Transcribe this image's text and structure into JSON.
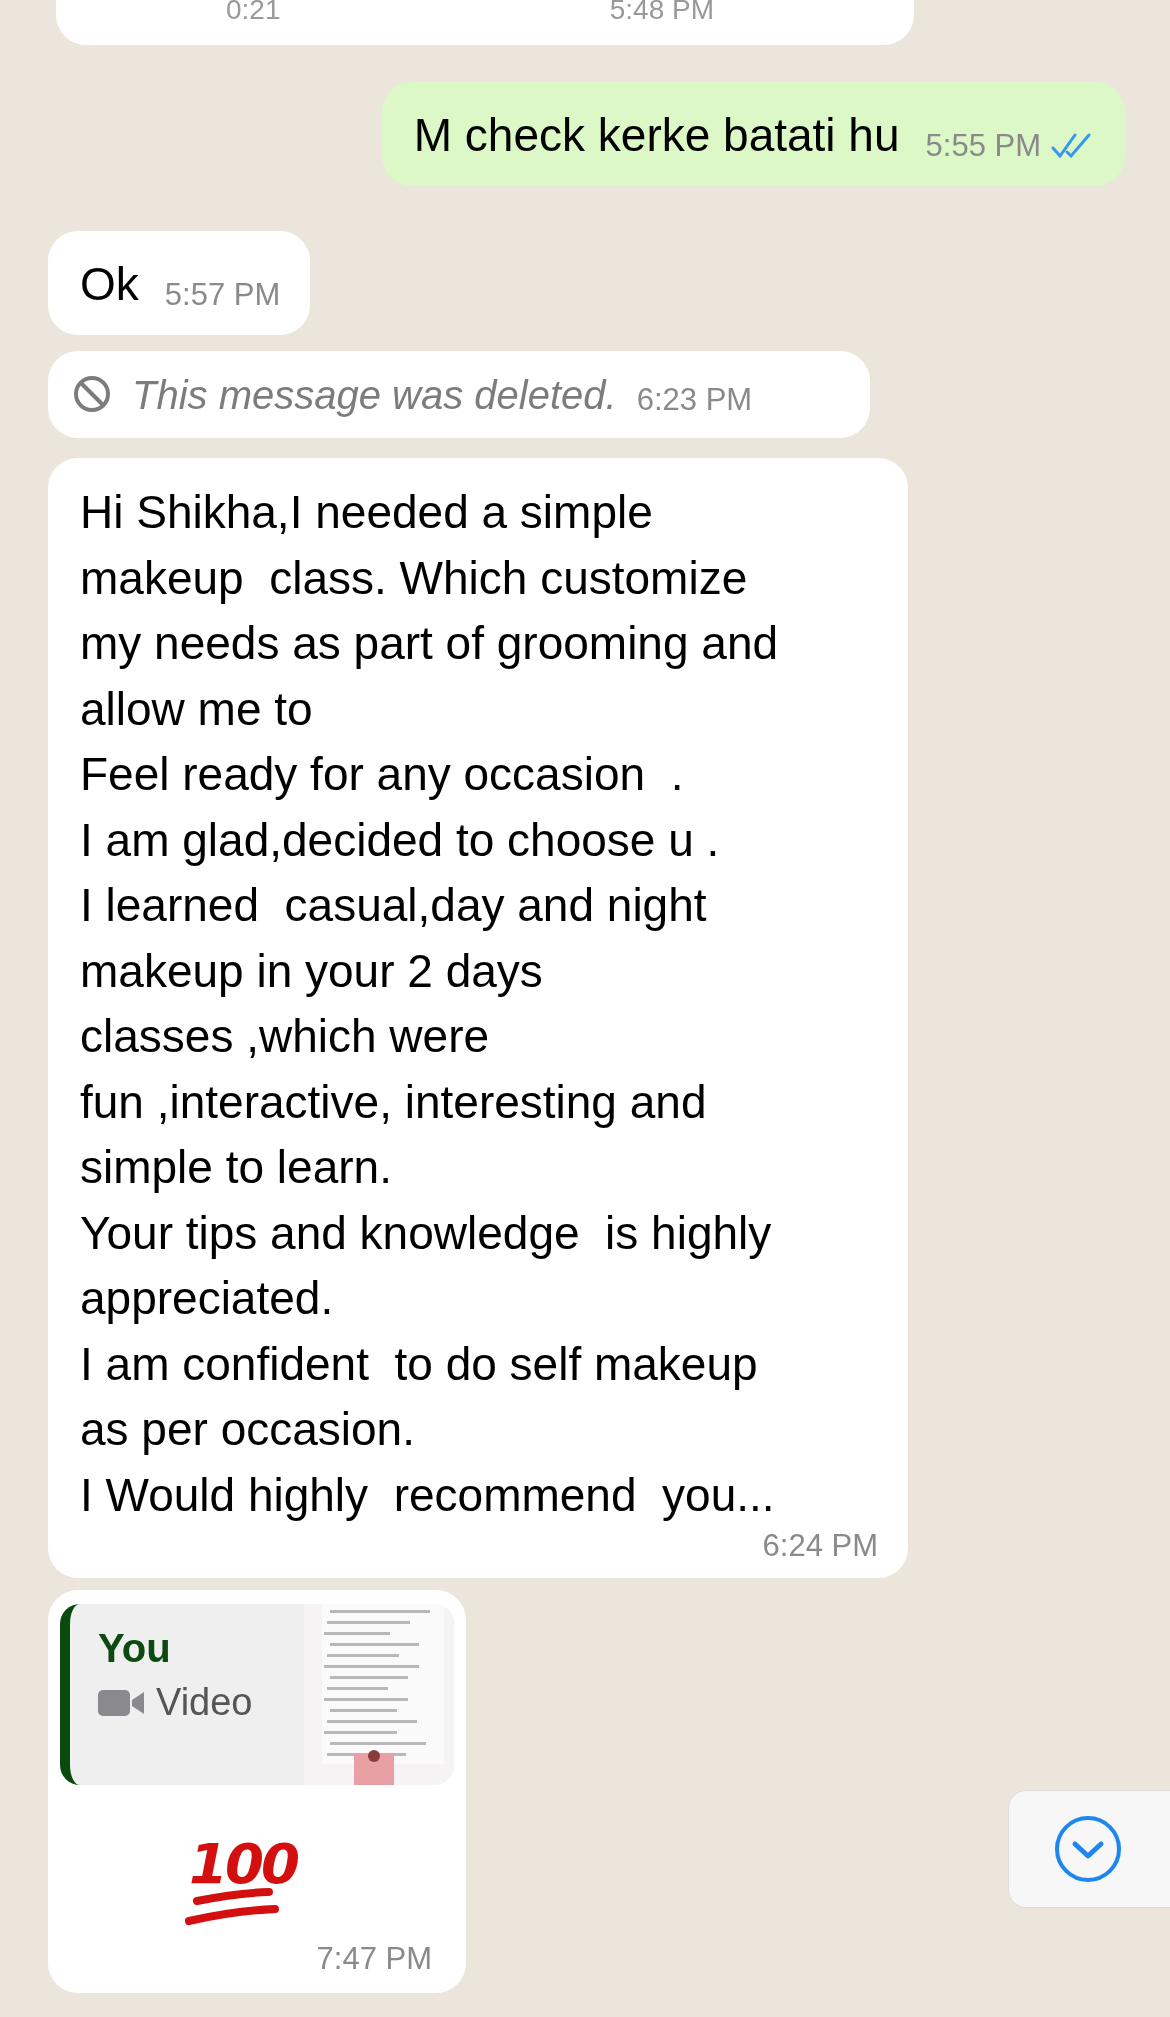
{
  "messages": [
    {
      "kind": "voice",
      "duration": "0:21",
      "time": "5:48 PM",
      "outgoing": false
    },
    {
      "kind": "text",
      "text": "M check kerke batati hu",
      "time": "5:55 PM",
      "outgoing": true,
      "read": true
    },
    {
      "kind": "text",
      "text": "Ok",
      "time": "5:57 PM",
      "outgoing": false
    },
    {
      "kind": "deleted",
      "text": "This message was deleted.",
      "time": "6:23 PM",
      "outgoing": false
    },
    {
      "kind": "long",
      "text": "Hi Shikha,I needed a simple\nmakeup  class. Which customize\nmy needs as part of grooming and\nallow me to\nFeel ready for any occasion  .\nI am glad,decided to choose u .\nI learned  casual,day and night\nmakeup in your 2 days\nclasses ,which were\nfun ,interactive, interesting and\nsimple to learn.\nYour tips and knowledge  is highly\nappreciated.\nI am confident  to do self makeup\nas per occasion.\nI Would highly  recommend  you...",
      "time": "6:24 PM",
      "outgoing": false
    },
    {
      "kind": "reply",
      "quote": {
        "author": "You",
        "media": "Video"
      },
      "emoji": "100",
      "time": "7:47 PM",
      "outgoing": false
    }
  ]
}
